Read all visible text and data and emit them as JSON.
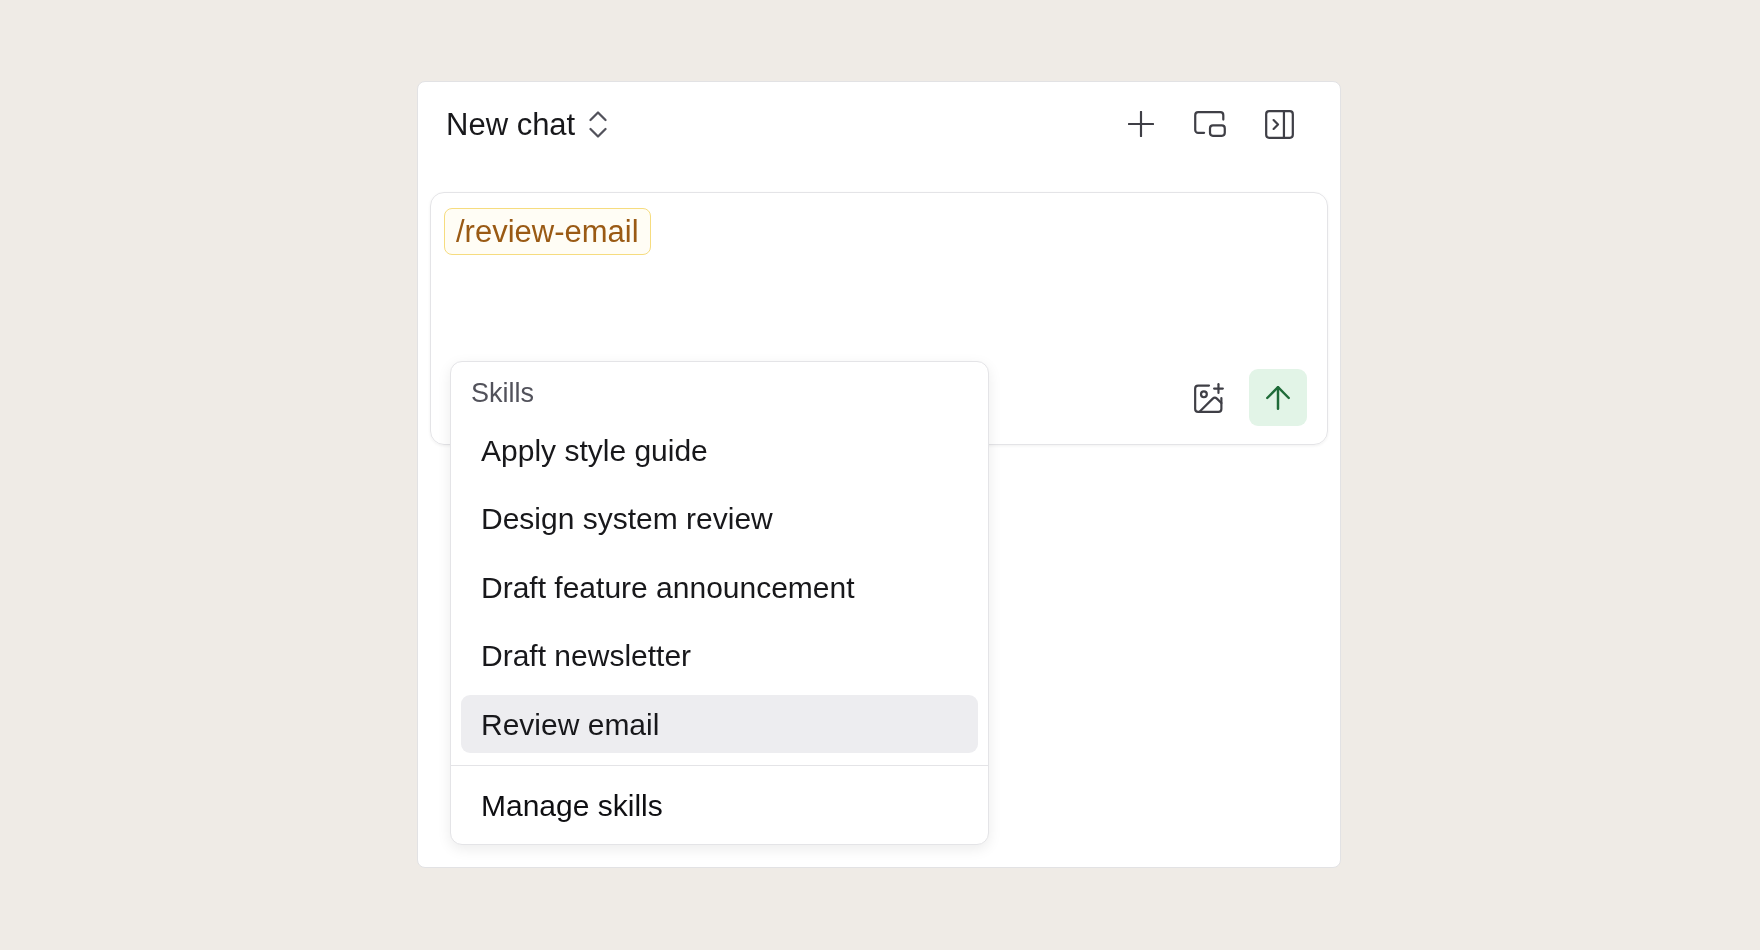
{
  "header": {
    "title": "New chat"
  },
  "composer": {
    "skill_tag": "/review-email"
  },
  "skills_menu": {
    "heading": "Skills",
    "items": [
      {
        "label": "Apply style guide",
        "selected": false
      },
      {
        "label": "Design system review",
        "selected": false
      },
      {
        "label": "Draft feature announcement",
        "selected": false
      },
      {
        "label": "Draft newsletter",
        "selected": false
      },
      {
        "label": "Review email",
        "selected": true
      }
    ],
    "footer_action": "Manage skills"
  }
}
